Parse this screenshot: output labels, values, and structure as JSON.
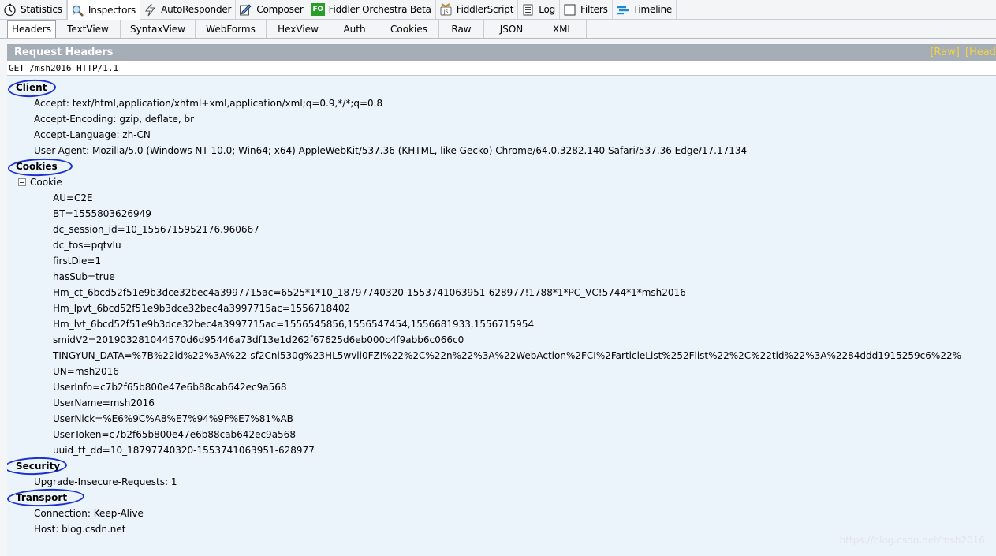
{
  "main_tabs": [
    {
      "label": "Statistics",
      "icon": "stopwatch-icon"
    },
    {
      "label": "Inspectors",
      "icon": "magnifier-icon"
    },
    {
      "label": "AutoResponder",
      "icon": "lightning-icon"
    },
    {
      "label": "Composer",
      "icon": "compose-icon"
    },
    {
      "label": "Fiddler Orchestra Beta",
      "icon": "fo-badge-icon",
      "badge": "FO"
    },
    {
      "label": "FiddlerScript",
      "icon": "script-icon"
    },
    {
      "label": "Log",
      "icon": "log-icon"
    },
    {
      "label": "Filters",
      "icon": "checkbox-icon"
    },
    {
      "label": "Timeline",
      "icon": "timeline-icon"
    }
  ],
  "sub_tabs": [
    "Headers",
    "TextView",
    "SyntaxView",
    "WebForms",
    "HexView",
    "Auth",
    "Cookies",
    "Raw",
    "JSON",
    "XML"
  ],
  "panel": {
    "title": "Request Headers",
    "links": "[Raw] [Head",
    "request_line": "GET /msh2016 HTTP/1.1"
  },
  "groups": {
    "client": {
      "label": "Client",
      "headers": [
        "Accept: text/html,application/xhtml+xml,application/xml;q=0.9,*/*;q=0.8",
        "Accept-Encoding: gzip, deflate, br",
        "Accept-Language: zh-CN",
        "User-Agent: Mozilla/5.0 (Windows NT 10.0; Win64; x64) AppleWebKit/537.36 (KHTML, like Gecko) Chrome/64.0.3282.140 Safari/537.36 Edge/17.17134"
      ]
    },
    "cookies": {
      "label": "Cookies",
      "node": "Cookie",
      "items": [
        "AU=C2E",
        "BT=1555803626949",
        "dc_session_id=10_1556715952176.960667",
        "dc_tos=pqtvlu",
        "firstDie=1",
        "hasSub=true",
        "Hm_ct_6bcd52f51e9b3dce32bec4a3997715ac=6525*1*10_18797740320-1553741063951-628977!1788*1*PC_VC!5744*1*msh2016",
        "Hm_lpvt_6bcd52f51e9b3dce32bec4a3997715ac=1556718402",
        "Hm_lvt_6bcd52f51e9b3dce32bec4a3997715ac=1556545856,1556547454,1556681933,1556715954",
        "smidV2=201903281044570d6d95446a73df13e1d262f67625d6eb000c4f9abb6c066c0",
        "TINGYUN_DATA=%7B%22id%22%3A%22-sf2Cni530g%23HL5wvli0FZI%22%2C%22n%22%3A%22WebAction%2FCI%2FarticleList%252Flist%22%2C%22tid%22%3A%2284ddd1915259c6%22%",
        "UN=msh2016",
        "UserInfo=c7b2f65b800e47e6b88cab642ec9a568",
        "UserName=msh2016",
        "UserNick=%E6%9C%A8%E7%94%9F%E7%81%AB",
        "UserToken=c7b2f65b800e47e6b88cab642ec9a568",
        "uuid_tt_dd=10_18797740320-1553741063951-628977"
      ]
    },
    "security": {
      "label": "Security",
      "headers": [
        "Upgrade-Insecure-Requests: 1"
      ]
    },
    "transport": {
      "label": "Transport",
      "headers": [
        "Connection: Keep-Alive",
        "Host: blog.csdn.net"
      ]
    }
  },
  "watermark": "https://blog.csdn.net/msh2016",
  "colors": {
    "panel_header": "#a5adb6",
    "content_bg": "#ebf3fb",
    "link_yellow": "#f5d33a",
    "annotation_ring": "#1a2fd0"
  }
}
